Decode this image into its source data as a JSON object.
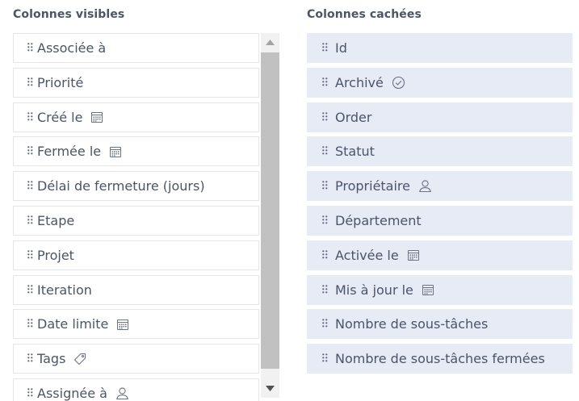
{
  "panels": {
    "visible_title": "Colonnes visibles",
    "hidden_title": "Colonnes cachées"
  },
  "visible_columns": [
    {
      "label": "Associée à",
      "icon": ""
    },
    {
      "label": "Priorité",
      "icon": ""
    },
    {
      "label": "Créé le",
      "icon": "calendar-icon"
    },
    {
      "label": "Fermée le",
      "icon": "calendar-icon"
    },
    {
      "label": "Délai de fermeture (jours)",
      "icon": ""
    },
    {
      "label": "Etape",
      "icon": ""
    },
    {
      "label": "Projet",
      "icon": ""
    },
    {
      "label": "Iteration",
      "icon": ""
    },
    {
      "label": "Date limite",
      "icon": "calendar-icon"
    },
    {
      "label": "Tags",
      "icon": "tag-icon"
    },
    {
      "label": "Assignée à",
      "icon": "user-icon"
    }
  ],
  "hidden_columns": [
    {
      "label": "Id",
      "icon": ""
    },
    {
      "label": "Archivé",
      "icon": "check-circle-icon"
    },
    {
      "label": "Order",
      "icon": ""
    },
    {
      "label": "Statut",
      "icon": ""
    },
    {
      "label": "Propriétaire",
      "icon": "user-icon"
    },
    {
      "label": "Département",
      "icon": ""
    },
    {
      "label": "Activée le",
      "icon": "calendar-icon"
    },
    {
      "label": "Mis à jour le",
      "icon": "calendar-icon"
    },
    {
      "label": "Nombre de sous-tâches",
      "icon": ""
    },
    {
      "label": "Nombre de sous-tâches fermées",
      "icon": ""
    }
  ],
  "colors": {
    "hidden_item_bg": "#e6ebf5",
    "text": "#4a5568",
    "border": "#e3e6ec",
    "scroll_thumb": "#c1c1c1"
  }
}
